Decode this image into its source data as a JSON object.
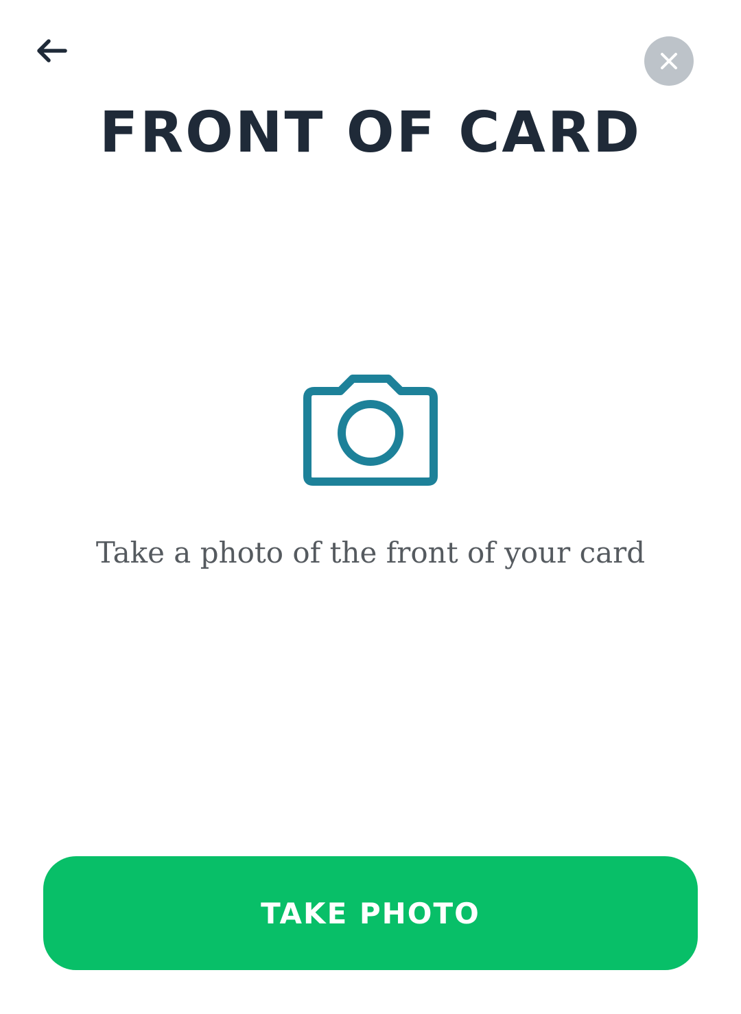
{
  "header": {
    "back_icon": "arrow-left-icon",
    "close_icon": "close-icon"
  },
  "main": {
    "title": "FRONT OF CARD",
    "camera_icon": "camera-icon",
    "instruction": "Take a photo of the front of your card"
  },
  "footer": {
    "take_photo_label": "TAKE PHOTO"
  },
  "colors": {
    "title": "#1f2a38",
    "accent_icon": "#1d8199",
    "button_bg": "#08bf68",
    "close_bg": "#bdc3c9",
    "instruction_text": "#555a5f"
  }
}
